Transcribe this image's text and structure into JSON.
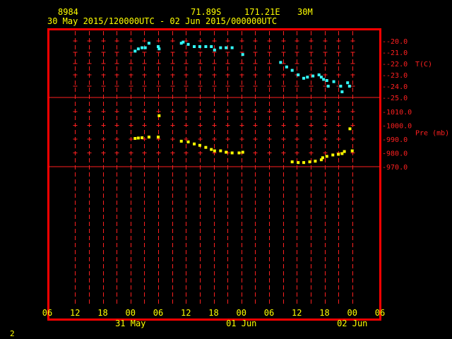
{
  "header": {
    "station": "8984",
    "lat": "71.89S",
    "lon": "171.21E",
    "level": "30M",
    "period": "30 May 2015/120000UTC - 02 Jun 2015/000000UTC"
  },
  "corner_label": "2",
  "colors": {
    "frame": "#ff0000",
    "grid": "#ff2020",
    "temperature": "#33ffff",
    "pressure": "#ffff00",
    "text": "#ffff00"
  },
  "chart_data": [
    {
      "type": "scatter",
      "ylabel": "T(C)",
      "ylim": [
        -25,
        -19.5
      ],
      "yticks": [
        "-20.0",
        "-21.0",
        "-22.0",
        "-23.0",
        "-24.0",
        "-25.0"
      ],
      "xlim": [
        -6,
        66
      ],
      "color": "#33ffff",
      "x": [
        13.0,
        13.7,
        14.5,
        15.2,
        16.0,
        18.0,
        18.2,
        23.0,
        23.4,
        24.5,
        25.8,
        27.0,
        28.3,
        29.5,
        30.2,
        31.5,
        32.7,
        34.0,
        36.3,
        44.5,
        45.8,
        47.0,
        48.3,
        49.5,
        50.3,
        51.5,
        52.8,
        53.3,
        53.8,
        54.5,
        54.8,
        56.0,
        57.5,
        57.8,
        59.0,
        59.4
      ],
      "y": [
        -20.9,
        -20.7,
        -20.6,
        -20.6,
        -20.2,
        -20.5,
        -20.7,
        -20.2,
        -20.1,
        -20.3,
        -20.5,
        -20.5,
        -20.5,
        -20.5,
        -20.8,
        -20.6,
        -20.6,
        -20.6,
        -21.2,
        -21.9,
        -22.3,
        -22.6,
        -23.0,
        -23.3,
        -23.2,
        -23.1,
        -23.0,
        -23.2,
        -23.4,
        -23.5,
        -24.0,
        -23.6,
        -24.0,
        -24.5,
        -23.7,
        -24.0
      ]
    },
    {
      "type": "scatter",
      "ylabel": "Pre (mb)",
      "ylim": [
        970,
        1015
      ],
      "yticks": [
        "1010.0",
        "1000.0",
        "990.0",
        "980.0",
        "970.0"
      ],
      "xlim": [
        -6,
        66
      ],
      "color": "#ffff00",
      "x": [
        13.0,
        13.7,
        14.5,
        16.0,
        18.0,
        18.2,
        23.0,
        24.5,
        25.8,
        27.0,
        28.3,
        29.5,
        30.2,
        31.5,
        32.7,
        34.0,
        35.5,
        36.3,
        47.0,
        48.3,
        49.5,
        50.8,
        52.0,
        53.3,
        53.6,
        54.5,
        55.8,
        57.0,
        57.8,
        58.3,
        59.5,
        60.0
      ],
      "y": [
        990.5,
        990.8,
        991.0,
        991.5,
        991.5,
        1007.0,
        988.5,
        988.0,
        986.5,
        985.5,
        984.0,
        982.5,
        981.5,
        981.5,
        980.5,
        980.0,
        980.0,
        980.5,
        973.5,
        973.0,
        973.0,
        973.5,
        974.0,
        975.0,
        976.5,
        977.5,
        978.5,
        979.0,
        979.5,
        981.0,
        997.5,
        981.5
      ]
    }
  ],
  "x_axis": {
    "hour_labels": [
      {
        "x": -6,
        "label": "06"
      },
      {
        "x": 0,
        "label": "12"
      },
      {
        "x": 6,
        "label": "18"
      },
      {
        "x": 12,
        "label": "00"
      },
      {
        "x": 18,
        "label": "06"
      },
      {
        "x": 24,
        "label": "12"
      },
      {
        "x": 30,
        "label": "18"
      },
      {
        "x": 36,
        "label": "00"
      },
      {
        "x": 42,
        "label": "06"
      },
      {
        "x": 48,
        "label": "12"
      },
      {
        "x": 54,
        "label": "18"
      },
      {
        "x": 60,
        "label": "00"
      },
      {
        "x": 66,
        "label": "06"
      }
    ],
    "date_labels": [
      {
        "x": 12,
        "label": "31 May"
      },
      {
        "x": 36,
        "label": "01 Jun"
      },
      {
        "x": 60,
        "label": "02 Jun"
      }
    ]
  }
}
